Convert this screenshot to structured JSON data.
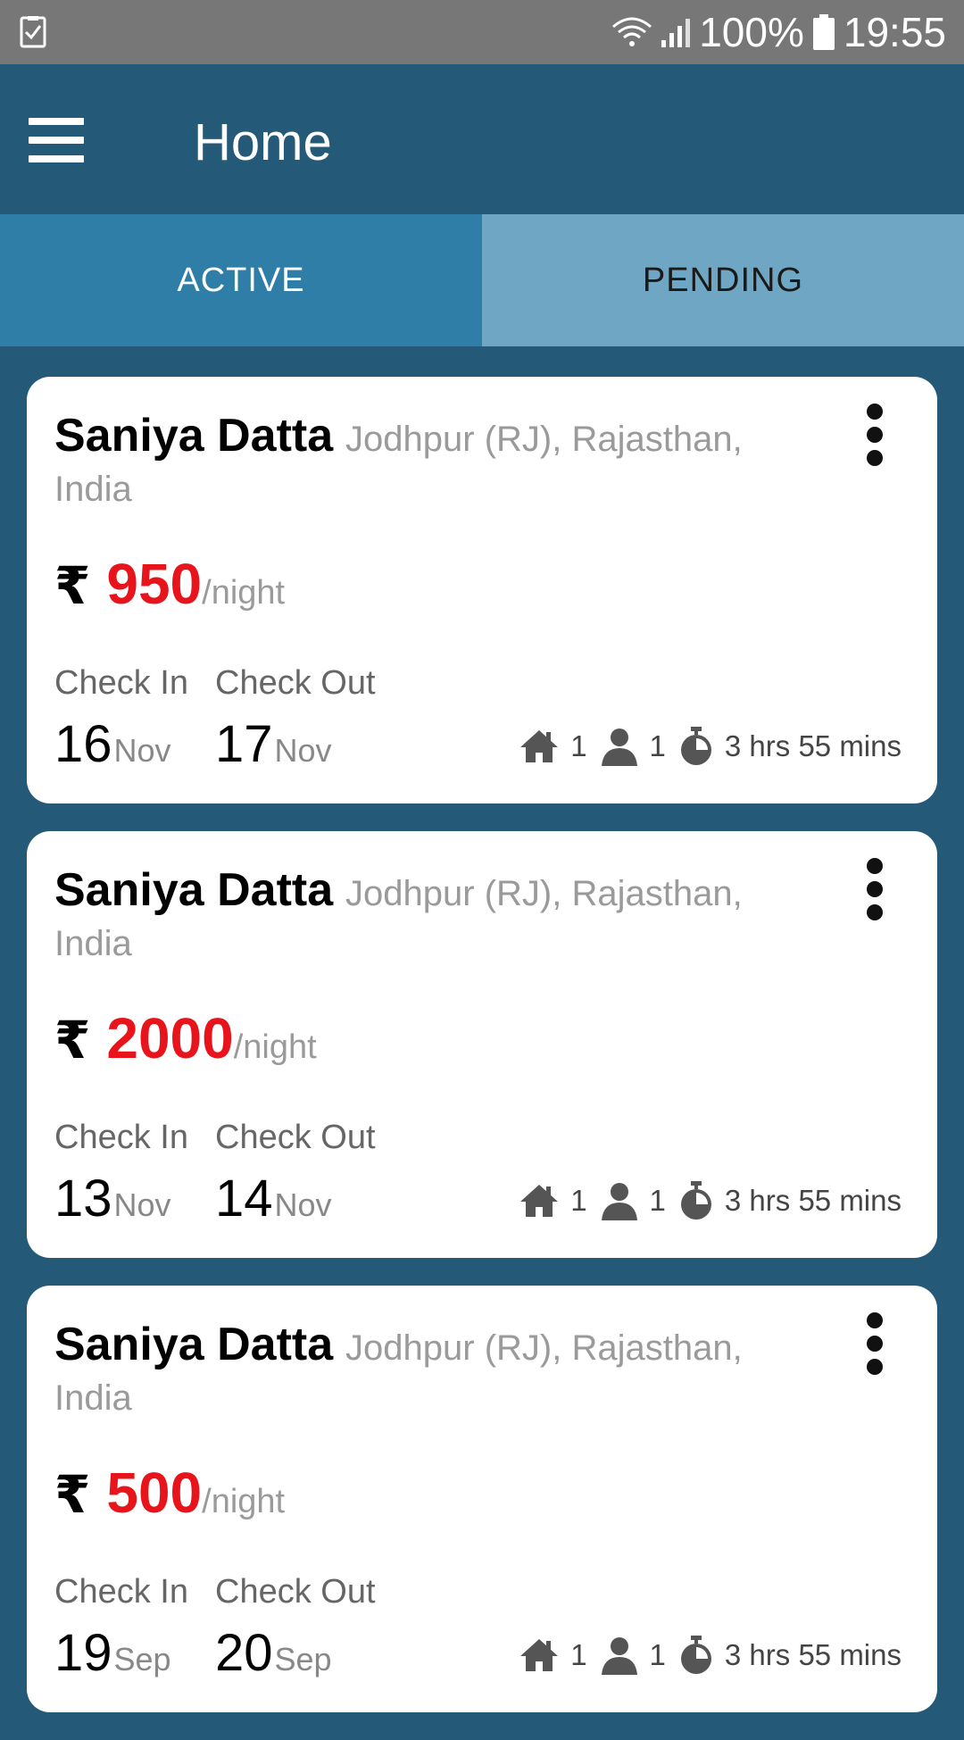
{
  "statusbar": {
    "battery": "100%",
    "time": "19:55",
    "icons": [
      "checklist-notification-icon",
      "wifi-icon",
      "signal-icon",
      "battery-icon"
    ]
  },
  "appbar": {
    "title": "Home",
    "menu_icon": "hamburger-menu-icon"
  },
  "tabs": [
    {
      "label": "ACTIVE",
      "selected": true
    },
    {
      "label": "PENDING",
      "selected": false
    }
  ],
  "colors": {
    "primary": "#245a78",
    "tab_active": "#2f7ea8",
    "tab_inactive": "#6ea6c4",
    "price": "#e8141c"
  },
  "bookings": [
    {
      "name": "Saniya Datta",
      "location": "Jodhpur (RJ), Rajasthan, India",
      "currency": "₹",
      "price": "950",
      "per": "/night",
      "checkin_label": "Check In",
      "checkout_label": "Check Out",
      "checkin_day": "16",
      "checkin_month": "Nov",
      "checkout_day": "17",
      "checkout_month": "Nov",
      "rooms": "1",
      "guests": "1",
      "duration": "3 hrs 55 mins"
    },
    {
      "name": "Saniya Datta",
      "location": "Jodhpur (RJ), Rajasthan, India",
      "currency": "₹",
      "price": "2000",
      "per": "/night",
      "checkin_label": "Check In",
      "checkout_label": "Check Out",
      "checkin_day": "13",
      "checkin_month": "Nov",
      "checkout_day": "14",
      "checkout_month": "Nov",
      "rooms": "1",
      "guests": "1",
      "duration": "3 hrs 55 mins"
    },
    {
      "name": "Saniya Datta",
      "location": "Jodhpur (RJ), Rajasthan, India",
      "currency": "₹",
      "price": "500",
      "per": "/night",
      "checkin_label": "Check In",
      "checkout_label": "Check Out",
      "checkin_day": "19",
      "checkin_month": "Sep",
      "checkout_day": "20",
      "checkout_month": "Sep",
      "rooms": "1",
      "guests": "1",
      "duration": "3 hrs 55 mins"
    }
  ]
}
